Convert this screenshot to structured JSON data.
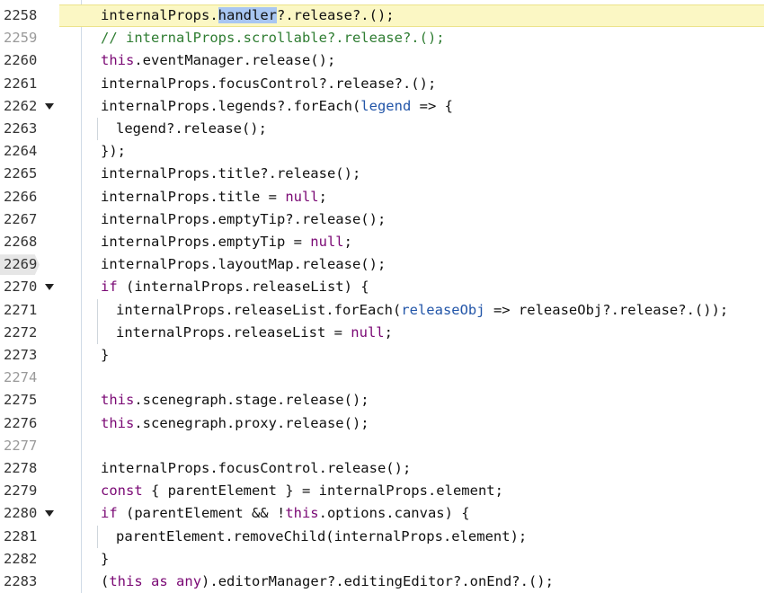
{
  "colors": {
    "keyword": "#7a0874",
    "comment": "#2f7d32",
    "param": "#2255a8",
    "active_line": "#fbf7c4",
    "selection": "#a8c6f2"
  },
  "lines": [
    {
      "num": "2258",
      "active": true,
      "parts": [
        [
          "t",
          "internalProps."
        ],
        [
          "sel",
          "handler"
        ],
        [
          "t",
          "?.release?.();"
        ]
      ]
    },
    {
      "num": "2259",
      "dim": true,
      "parts": [
        [
          "cmt",
          "// internalProps.scrollable?.release?.();"
        ]
      ]
    },
    {
      "num": "2260",
      "parts": [
        [
          "kw",
          "this"
        ],
        [
          "t",
          ".eventManager.release();"
        ]
      ]
    },
    {
      "num": "2261",
      "parts": [
        [
          "t",
          "internalProps.focusControl?.release?.();"
        ]
      ]
    },
    {
      "num": "2262",
      "fold": true,
      "parts": [
        [
          "t",
          "internalProps.legends?.forEach("
        ],
        [
          "param",
          "legend"
        ],
        [
          "t",
          " => {"
        ]
      ]
    },
    {
      "num": "2263",
      "indent": 1,
      "parts": [
        [
          "t",
          "legend?.release();"
        ]
      ]
    },
    {
      "num": "2264",
      "parts": [
        [
          "t",
          "});"
        ]
      ]
    },
    {
      "num": "2265",
      "parts": [
        [
          "t",
          "internalProps.title?.release();"
        ]
      ]
    },
    {
      "num": "2266",
      "parts": [
        [
          "t",
          "internalProps.title = "
        ],
        [
          "kw",
          "null"
        ],
        [
          "t",
          ";"
        ]
      ]
    },
    {
      "num": "2267",
      "parts": [
        [
          "t",
          "internalProps.emptyTip?.release();"
        ]
      ]
    },
    {
      "num": "2268",
      "parts": [
        [
          "t",
          "internalProps.emptyTip = "
        ],
        [
          "kw",
          "null"
        ],
        [
          "t",
          ";"
        ]
      ]
    },
    {
      "num": "2269",
      "marker": true,
      "parts": [
        [
          "t",
          "internalProps.layoutMap.release();"
        ]
      ]
    },
    {
      "num": "2270",
      "fold": true,
      "parts": [
        [
          "kw",
          "if"
        ],
        [
          "t",
          " (internalProps.releaseList) {"
        ]
      ]
    },
    {
      "num": "2271",
      "indent": 1,
      "parts": [
        [
          "t",
          "internalProps.releaseList.forEach("
        ],
        [
          "param",
          "releaseObj"
        ],
        [
          "t",
          " => releaseObj?.release?.());"
        ]
      ]
    },
    {
      "num": "2272",
      "indent": 1,
      "parts": [
        [
          "t",
          "internalProps.releaseList = "
        ],
        [
          "kw",
          "null"
        ],
        [
          "t",
          ";"
        ]
      ]
    },
    {
      "num": "2273",
      "parts": [
        [
          "t",
          "}"
        ]
      ]
    },
    {
      "num": "2274",
      "dim": true,
      "parts": []
    },
    {
      "num": "2275",
      "parts": [
        [
          "kw",
          "this"
        ],
        [
          "t",
          ".scenegraph.stage.release();"
        ]
      ]
    },
    {
      "num": "2276",
      "parts": [
        [
          "kw",
          "this"
        ],
        [
          "t",
          ".scenegraph.proxy.release();"
        ]
      ]
    },
    {
      "num": "2277",
      "dim": true,
      "parts": []
    },
    {
      "num": "2278",
      "parts": [
        [
          "t",
          "internalProps.focusControl.release();"
        ]
      ]
    },
    {
      "num": "2279",
      "parts": [
        [
          "kw",
          "const"
        ],
        [
          "t",
          " { parentElement } = internalProps.element;"
        ]
      ]
    },
    {
      "num": "2280",
      "fold": true,
      "parts": [
        [
          "kw",
          "if"
        ],
        [
          "t",
          " (parentElement && !"
        ],
        [
          "kw",
          "this"
        ],
        [
          "t",
          ".options.canvas) {"
        ]
      ]
    },
    {
      "num": "2281",
      "indent": 1,
      "parts": [
        [
          "t",
          "parentElement.removeChild(internalProps.element);"
        ]
      ]
    },
    {
      "num": "2282",
      "parts": [
        [
          "t",
          "}"
        ]
      ]
    },
    {
      "num": "2283",
      "parts": [
        [
          "t",
          "("
        ],
        [
          "kw",
          "this"
        ],
        [
          "t",
          " "
        ],
        [
          "kw",
          "as"
        ],
        [
          "t",
          " "
        ],
        [
          "kw",
          "any"
        ],
        [
          "t",
          ").editorManager?.editingEditor?.onEnd?.();"
        ]
      ]
    }
  ]
}
